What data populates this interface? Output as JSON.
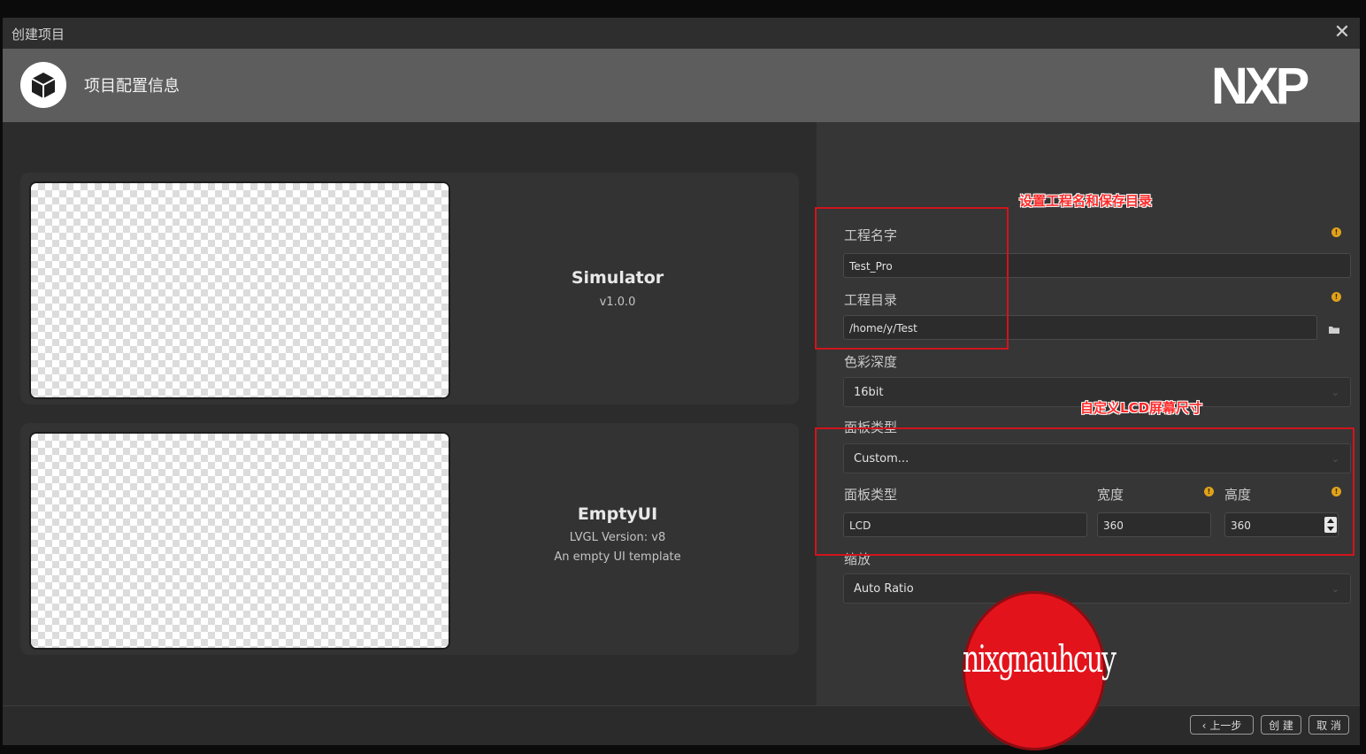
{
  "window": {
    "title": "创建项目",
    "close_icon": "close-icon"
  },
  "header": {
    "title": "项目配置信息",
    "brand": "NXP"
  },
  "templates": [
    {
      "name": "Simulator",
      "lines": [
        "v1.0.0"
      ]
    },
    {
      "name": "EmptyUI",
      "lines": [
        "LVGL Version: v8",
        "An empty UI template"
      ]
    }
  ],
  "form": {
    "project_name": {
      "label": "工程名字",
      "value": "Test_Pro"
    },
    "project_dir": {
      "label": "工程目录",
      "value": "/home/y/Test"
    },
    "color_depth": {
      "label": "色彩深度",
      "value": "16bit"
    },
    "panel_type": {
      "label": "面板类型",
      "value": "Custom..."
    },
    "panel_kind": {
      "label": "面板类型",
      "value": "LCD"
    },
    "width": {
      "label": "宽度",
      "value": "360"
    },
    "height": {
      "label": "高度",
      "value": "360"
    },
    "scale": {
      "label": "缩放",
      "value": "Auto Ratio"
    }
  },
  "annotations": {
    "name_dir": "设置工程名和保存目录",
    "lcd_size": "自定义LCD屏幕尺寸"
  },
  "stamp": {
    "text": "nixgnauhcuy"
  },
  "footer": {
    "prev": "上一步",
    "create": "创 建",
    "cancel": "取 消"
  },
  "colors": {
    "annotation_red": "#d0141c",
    "info_orange": "#e0a21a",
    "stamp_red": "#e3131c"
  }
}
